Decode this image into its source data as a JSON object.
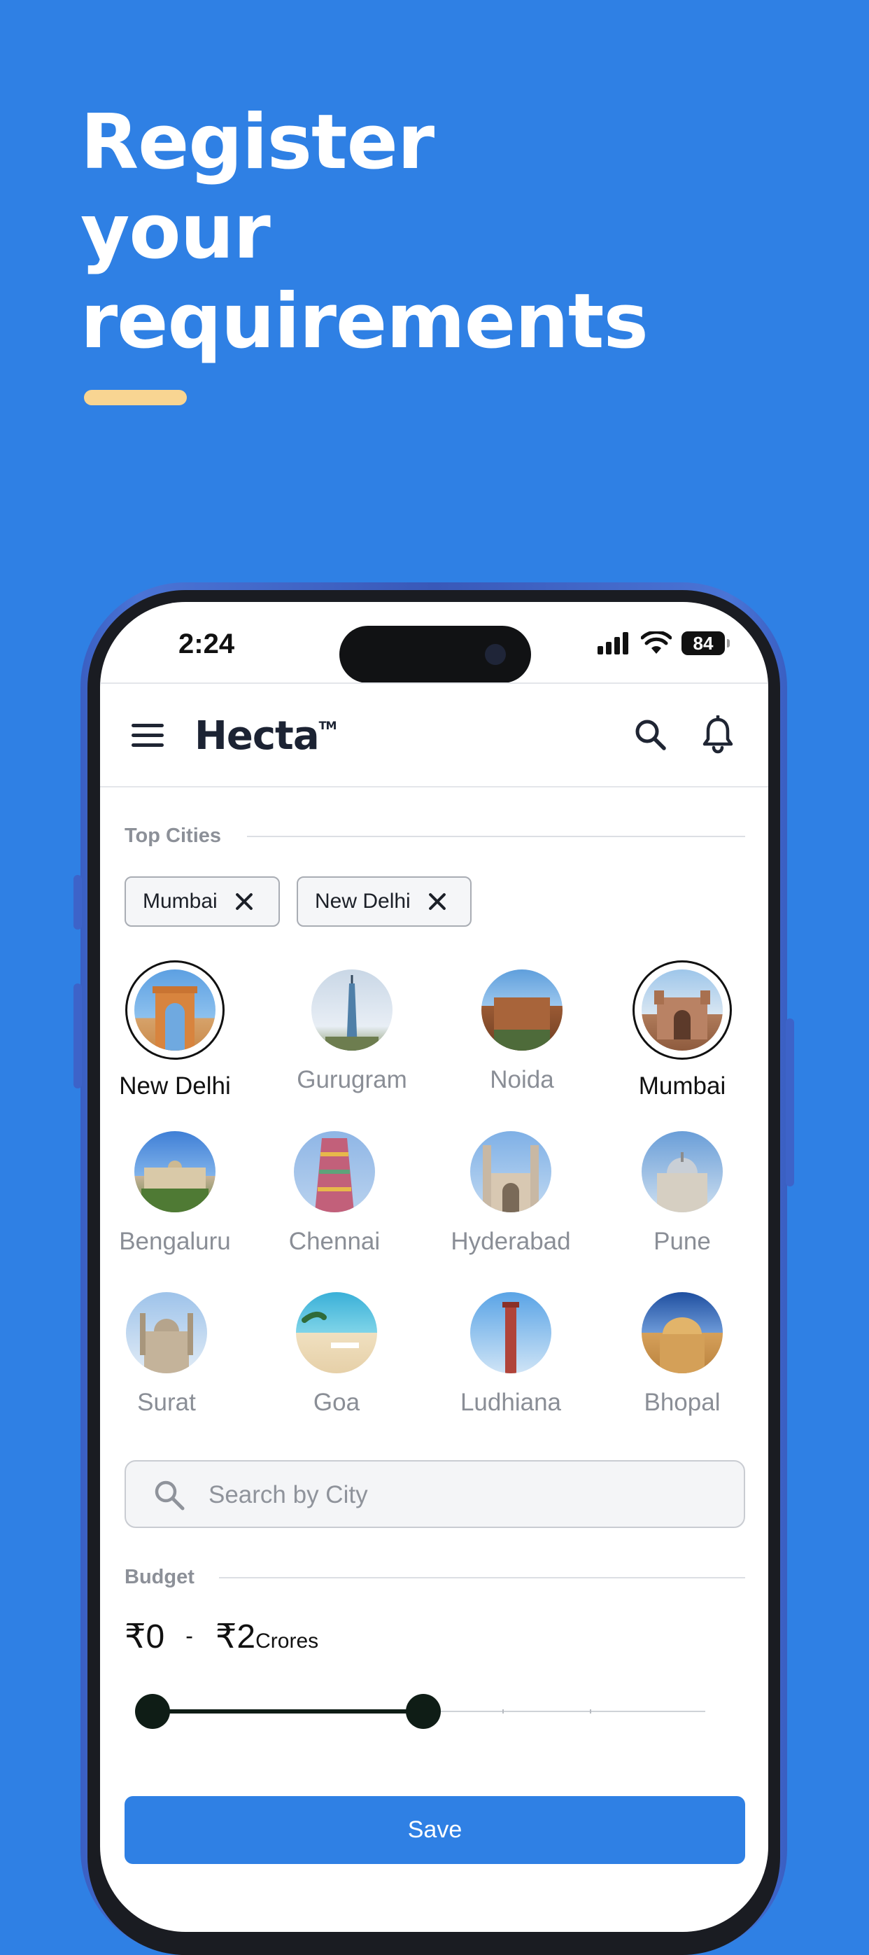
{
  "promo": {
    "headline_lines": [
      "Register",
      "your",
      "requirements"
    ]
  },
  "status_bar": {
    "time": "2:24",
    "battery": "84"
  },
  "header": {
    "brand": "Hecta",
    "trademark": "TM"
  },
  "top_cities": {
    "label": "Top Cities",
    "selected_chips": [
      {
        "label": "Mumbai"
      },
      {
        "label": "New Delhi"
      }
    ],
    "cities": [
      {
        "name": "New Delhi",
        "selected": true
      },
      {
        "name": "Gurugram",
        "selected": false
      },
      {
        "name": "Noida",
        "selected": false
      },
      {
        "name": "Mumbai",
        "selected": true
      },
      {
        "name": "Bengaluru",
        "selected": false
      },
      {
        "name": "Chennai",
        "selected": false
      },
      {
        "name": "Hyderabad",
        "selected": false
      },
      {
        "name": "Pune",
        "selected": false
      },
      {
        "name": "Surat",
        "selected": false
      },
      {
        "name": "Goa",
        "selected": false
      },
      {
        "name": "Ludhiana",
        "selected": false
      },
      {
        "name": "Bhopal",
        "selected": false
      }
    ]
  },
  "search": {
    "placeholder": "Search by City",
    "value": ""
  },
  "budget": {
    "label": "Budget",
    "min_label": "₹0",
    "dash": "-",
    "max_label": "₹2",
    "unit": "Crores",
    "slider_min_fraction": 0,
    "slider_max_fraction": 0.49
  },
  "actions": {
    "save_label": "Save"
  },
  "colors": {
    "background": "#2f80e4",
    "accent_underline": "#f8d592",
    "primary_button": "#2f80e4",
    "slider": "#0f1d16"
  }
}
